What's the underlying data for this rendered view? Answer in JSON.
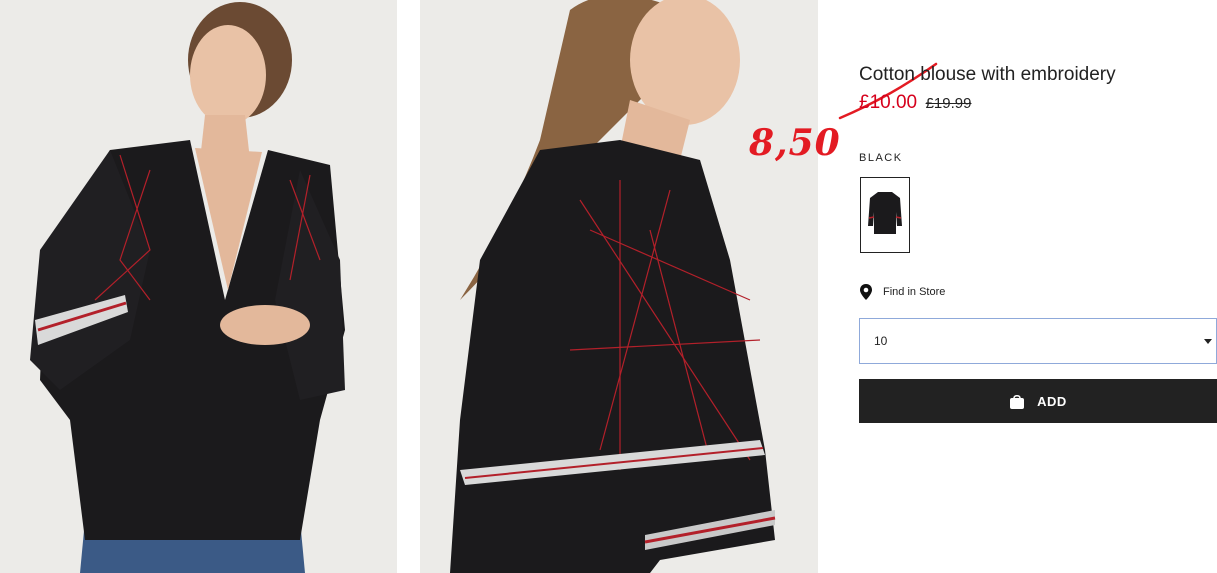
{
  "product": {
    "title": "Cotton blouse with embroidery",
    "sale_price": "£10.00",
    "original_price": "£19.99",
    "annotated_price": "8,50",
    "color_label": "BLACK",
    "swatch_icon": "blouse-thumbnail",
    "find_in_store_label": "Find in Store",
    "find_in_store_icon": "location-pin-icon",
    "size_selected": "10",
    "add_label": "ADD",
    "add_icon": "shopping-bag-icon"
  },
  "colors": {
    "sale": "#d6001c",
    "annotation": "#e31b23",
    "button": "#222222",
    "select_border": "#8fa9da"
  },
  "images": [
    {
      "name": "model-front-photo"
    },
    {
      "name": "model-side-photo"
    }
  ]
}
